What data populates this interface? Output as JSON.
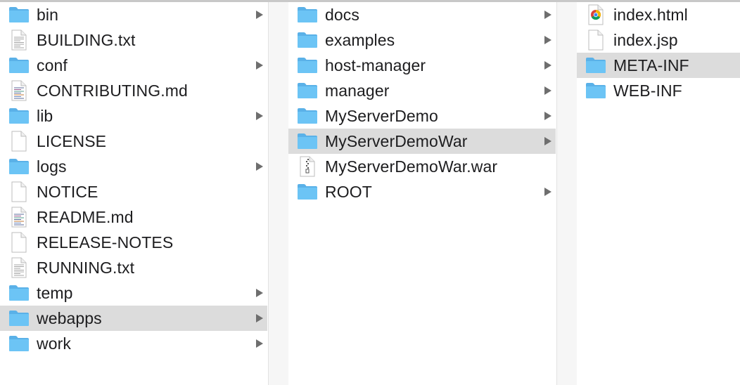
{
  "columns": [
    {
      "items": [
        {
          "label": "bin",
          "icon": "folder-icon",
          "has_arrow": true,
          "selected": false
        },
        {
          "label": "BUILDING.txt",
          "icon": "text-file-icon",
          "has_arrow": false,
          "selected": false
        },
        {
          "label": "conf",
          "icon": "folder-icon",
          "has_arrow": true,
          "selected": false
        },
        {
          "label": "CONTRIBUTING.md",
          "icon": "markdown-file-icon",
          "has_arrow": false,
          "selected": false
        },
        {
          "label": "lib",
          "icon": "folder-icon",
          "has_arrow": true,
          "selected": false
        },
        {
          "label": "LICENSE",
          "icon": "blank-file-icon",
          "has_arrow": false,
          "selected": false
        },
        {
          "label": "logs",
          "icon": "folder-icon",
          "has_arrow": true,
          "selected": false
        },
        {
          "label": "NOTICE",
          "icon": "blank-file-icon",
          "has_arrow": false,
          "selected": false
        },
        {
          "label": "README.md",
          "icon": "markdown-file-icon",
          "has_arrow": false,
          "selected": false
        },
        {
          "label": "RELEASE-NOTES",
          "icon": "blank-file-icon",
          "has_arrow": false,
          "selected": false
        },
        {
          "label": "RUNNING.txt",
          "icon": "text-file-icon",
          "has_arrow": false,
          "selected": false
        },
        {
          "label": "temp",
          "icon": "folder-icon",
          "has_arrow": true,
          "selected": false
        },
        {
          "label": "webapps",
          "icon": "folder-icon",
          "has_arrow": true,
          "selected": true
        },
        {
          "label": "work",
          "icon": "folder-icon",
          "has_arrow": true,
          "selected": false
        }
      ]
    },
    {
      "items": [
        {
          "label": "docs",
          "icon": "folder-icon",
          "has_arrow": true,
          "selected": false
        },
        {
          "label": "examples",
          "icon": "folder-icon",
          "has_arrow": true,
          "selected": false
        },
        {
          "label": "host-manager",
          "icon": "folder-icon",
          "has_arrow": true,
          "selected": false
        },
        {
          "label": "manager",
          "icon": "folder-icon",
          "has_arrow": true,
          "selected": false
        },
        {
          "label": "MyServerDemo",
          "icon": "folder-icon",
          "has_arrow": true,
          "selected": false
        },
        {
          "label": "MyServerDemoWar",
          "icon": "folder-icon",
          "has_arrow": true,
          "selected": true
        },
        {
          "label": "MyServerDemoWar.war",
          "icon": "archive-file-icon",
          "has_arrow": false,
          "selected": false
        },
        {
          "label": "ROOT",
          "icon": "folder-icon",
          "has_arrow": true,
          "selected": false
        }
      ]
    },
    {
      "items": [
        {
          "label": "index.html",
          "icon": "chrome-html-file-icon",
          "has_arrow": false,
          "selected": false
        },
        {
          "label": "index.jsp",
          "icon": "blank-file-icon",
          "has_arrow": false,
          "selected": false
        },
        {
          "label": "META-INF",
          "icon": "folder-icon",
          "has_arrow": false,
          "selected": true
        },
        {
          "label": "WEB-INF",
          "icon": "folder-icon",
          "has_arrow": false,
          "selected": false
        }
      ]
    }
  ],
  "colors": {
    "folder_front": "#6cc4f5",
    "folder_back": "#5ab1e8",
    "selection": "#dcdcdc",
    "arrow": "#6e6e6e"
  }
}
